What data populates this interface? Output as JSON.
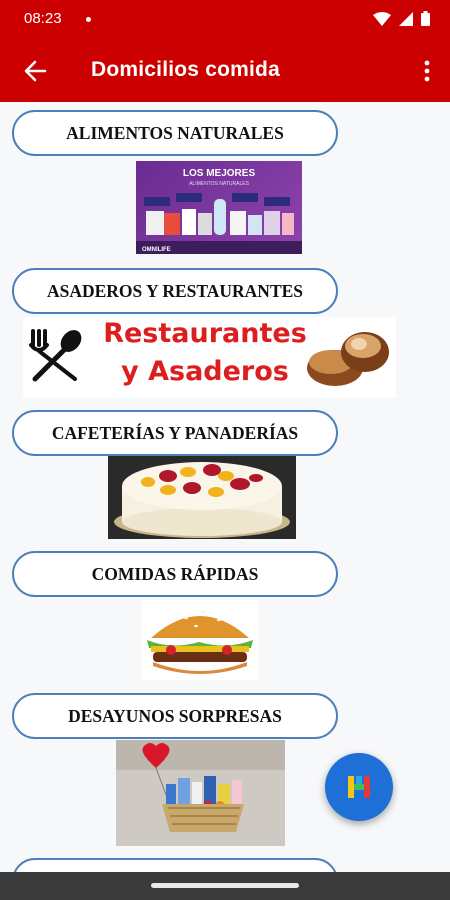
{
  "status": {
    "time": "08:23"
  },
  "app_bar": {
    "title": "Domicilios comida"
  },
  "categories": [
    {
      "label": "ALIMENTOS NATURALES",
      "image": {
        "heading": "LOS MEJORES",
        "subheading": "ALIMENTOS NATURALES",
        "brand": "OMNILIFE"
      }
    },
    {
      "label": "ASADEROS Y RESTAURANTES",
      "image": {
        "line1": "Restaurantes",
        "line2": "y Asaderos"
      }
    },
    {
      "label": "CAFETERÍAS Y PANADERÍAS"
    },
    {
      "label": "COMIDAS RÁPIDAS"
    },
    {
      "label": "DESAYUNOS SORPRESAS"
    }
  ],
  "colors": {
    "brand_red": "#cc0000",
    "button_border": "#4d7fb8",
    "fab_blue": "#1e6fd6"
  },
  "icons": {
    "back": "arrow-left-icon",
    "overflow": "more-vertical-icon",
    "fab": "app-logo-icon"
  }
}
